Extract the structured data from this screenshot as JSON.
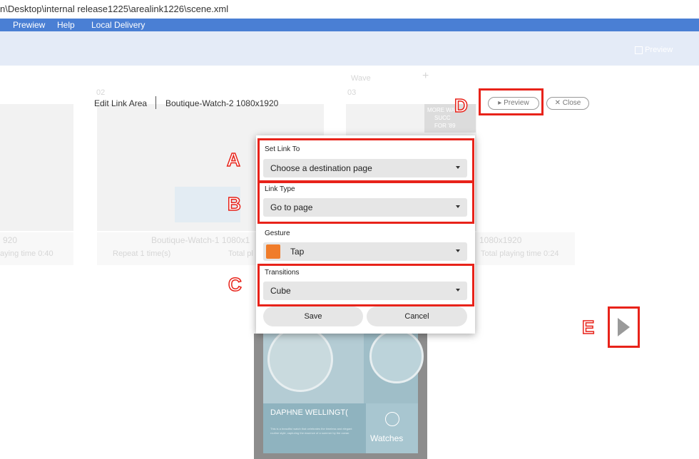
{
  "window": {
    "path": "n\\Desktop\\internal release1225\\arealink1226\\scene.xml"
  },
  "menu": {
    "items": [
      "Prewiew",
      "Help",
      "Local Delivery"
    ]
  },
  "ribbon": {
    "preview_label": "Preview"
  },
  "background": {
    "page_03": "03",
    "page_02": "02",
    "card_left_size": "920",
    "card_left_time": "aying time 0:40",
    "card_mid_title": "Boutique-Watch-1 1080x1",
    "card_mid_repeat": "Repeat 1 time(s)",
    "card_mid_total": "Total pl",
    "card_right_size": "1080x1920",
    "card_right_time": "Total playing time 0:24",
    "top_mid_text": "Wave",
    "top_plus": "+",
    "promo_line1": "MORE WA",
    "promo_line2": "SUCC",
    "promo_line3": "FOR '89"
  },
  "header": {
    "title": "Edit Link Area",
    "subtitle": "Boutique-Watch-2 1080x1920",
    "preview_button": "Preview",
    "close_button": "Close"
  },
  "dialog": {
    "set_link_to_label": "Set Link To",
    "set_link_to_value": "Choose a destination page",
    "link_type_label": "Link Type",
    "link_type_value": "Go to page",
    "gesture_label": "Gesture",
    "gesture_value": "Tap",
    "transitions_label": "Transitions",
    "transitions_value": "Cube",
    "save_button": "Save",
    "cancel_button": "Cancel"
  },
  "callouts": {
    "a": "A",
    "b": "B",
    "c": "C",
    "d": "D",
    "e": "E"
  },
  "phone": {
    "brand_text": "DAPHNE WELLINGT(",
    "watches_label": "Watches",
    "caption": "This is a beautiful watch that celebrates the timeless and elegant routine style, capturing the essence of a summer by the ocean."
  },
  "colors": {
    "menubar": "#4a7fd4",
    "ribbon": "#e4ebf7",
    "callout_red": "#e8231a",
    "gesture_icon": "#f07c2a"
  }
}
